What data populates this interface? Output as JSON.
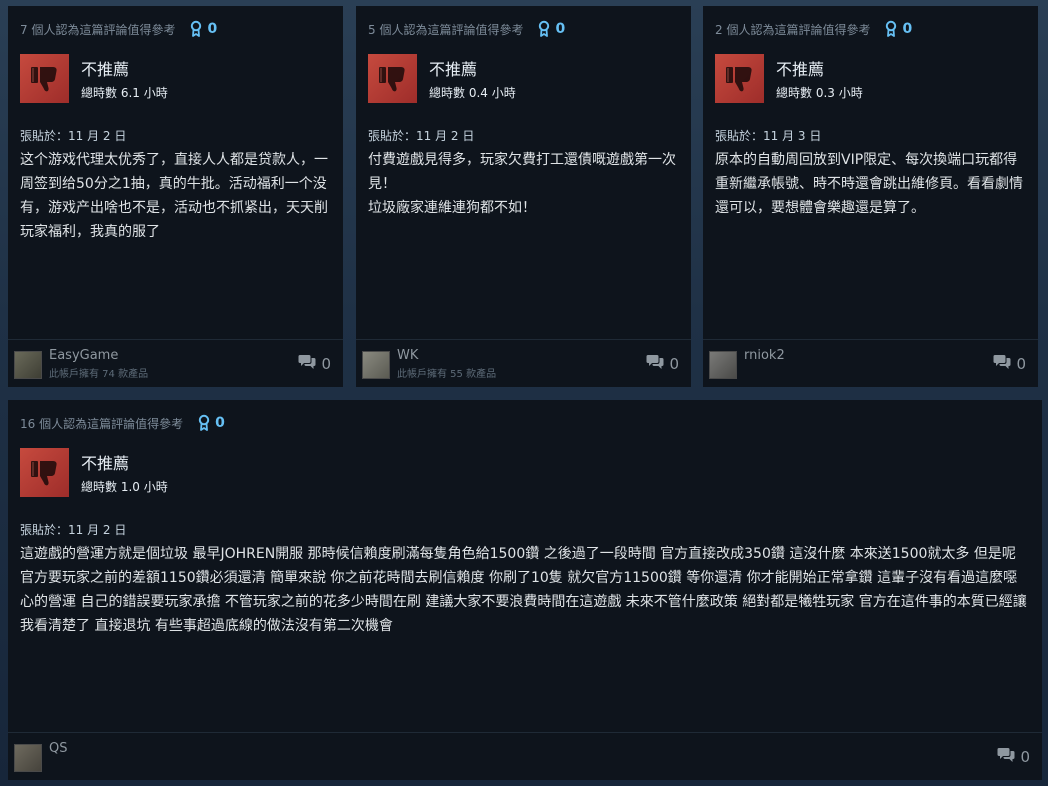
{
  "reviews": [
    {
      "helpful_text": "7 個人認為這篇評論值得參考",
      "award_count": "0",
      "verdict": "不推薦",
      "hours": "總時數 6.1 小時",
      "posted": "張貼於：11 月 2 日",
      "body": "这个游戏代理太优秀了，直接人人都是贷款人，一周签到给50分之1抽，真的牛批。活动福利一个没有，游戏产出啥也不是，活动也不抓紧出，天天削玩家福利，我真的服了",
      "user_name": "EasyGame",
      "user_products": "此帳戶擁有 74 款產品",
      "comment_count": "0"
    },
    {
      "helpful_text": "5 個人認為這篇評論值得參考",
      "award_count": "0",
      "verdict": "不推薦",
      "hours": "總時數 0.4 小時",
      "posted": "張貼於：11 月 2 日",
      "body": "付費遊戲見得多，玩家欠費打工還債嘅遊戲第一次見！\n垃圾廠家連維連狗都不如！",
      "user_name": "WK",
      "user_products": "此帳戶擁有 55 款產品",
      "comment_count": "0"
    },
    {
      "helpful_text": "2 個人認為這篇評論值得參考",
      "award_count": "0",
      "verdict": "不推薦",
      "hours": "總時數 0.3 小時",
      "posted": "張貼於：11 月 3 日",
      "body": "原本的自動周回放到VIP限定、每次換端口玩都得重新繼承帳號、時不時還會跳出維修頁。看看劇情還可以，要想體會樂趣還是算了。",
      "user_name": "rniok2",
      "user_products": "",
      "comment_count": "0"
    },
    {
      "helpful_text": "16 個人認為這篇評論值得參考",
      "award_count": "0",
      "verdict": "不推薦",
      "hours": "總時數 1.0 小時",
      "posted": "張貼於：11 月 2 日",
      "body": "這遊戲的營運方就是個垃圾 最早JOHREN開服 那時候信賴度刷滿每隻角色給1500鑽 之後過了一段時間 官方直接改成350鑽 這沒什麼 本來送1500就太多 但是呢 官方要玩家之前的差額1150鑽必須還清 簡單來說 你之前花時間去刷信賴度 你刷了10隻 就欠官方11500鑽 等你還清 你才能開始正常拿鑽 這輩子沒有看過這麼噁心的營運 自己的錯誤要玩家承擔 不管玩家之前的花多少時間在刷 建議大家不要浪費時間在這遊戲 未來不管什麼政策 絕對都是犧牲玩家 官方在這件事的本質已經讓我看清楚了 直接退坑 有些事超過底線的做法沒有第二次機會",
      "user_name": "QS",
      "user_products": "",
      "comment_count": "0"
    }
  ],
  "colors": {
    "thumb_red": "#b33a33",
    "award_blue": "#66c0f4",
    "card_bg": "#0e141c"
  },
  "icons": {
    "thumb": "thumbs-down-icon",
    "award": "award-ribbon-icon",
    "comment": "comment-bubble-icon"
  }
}
